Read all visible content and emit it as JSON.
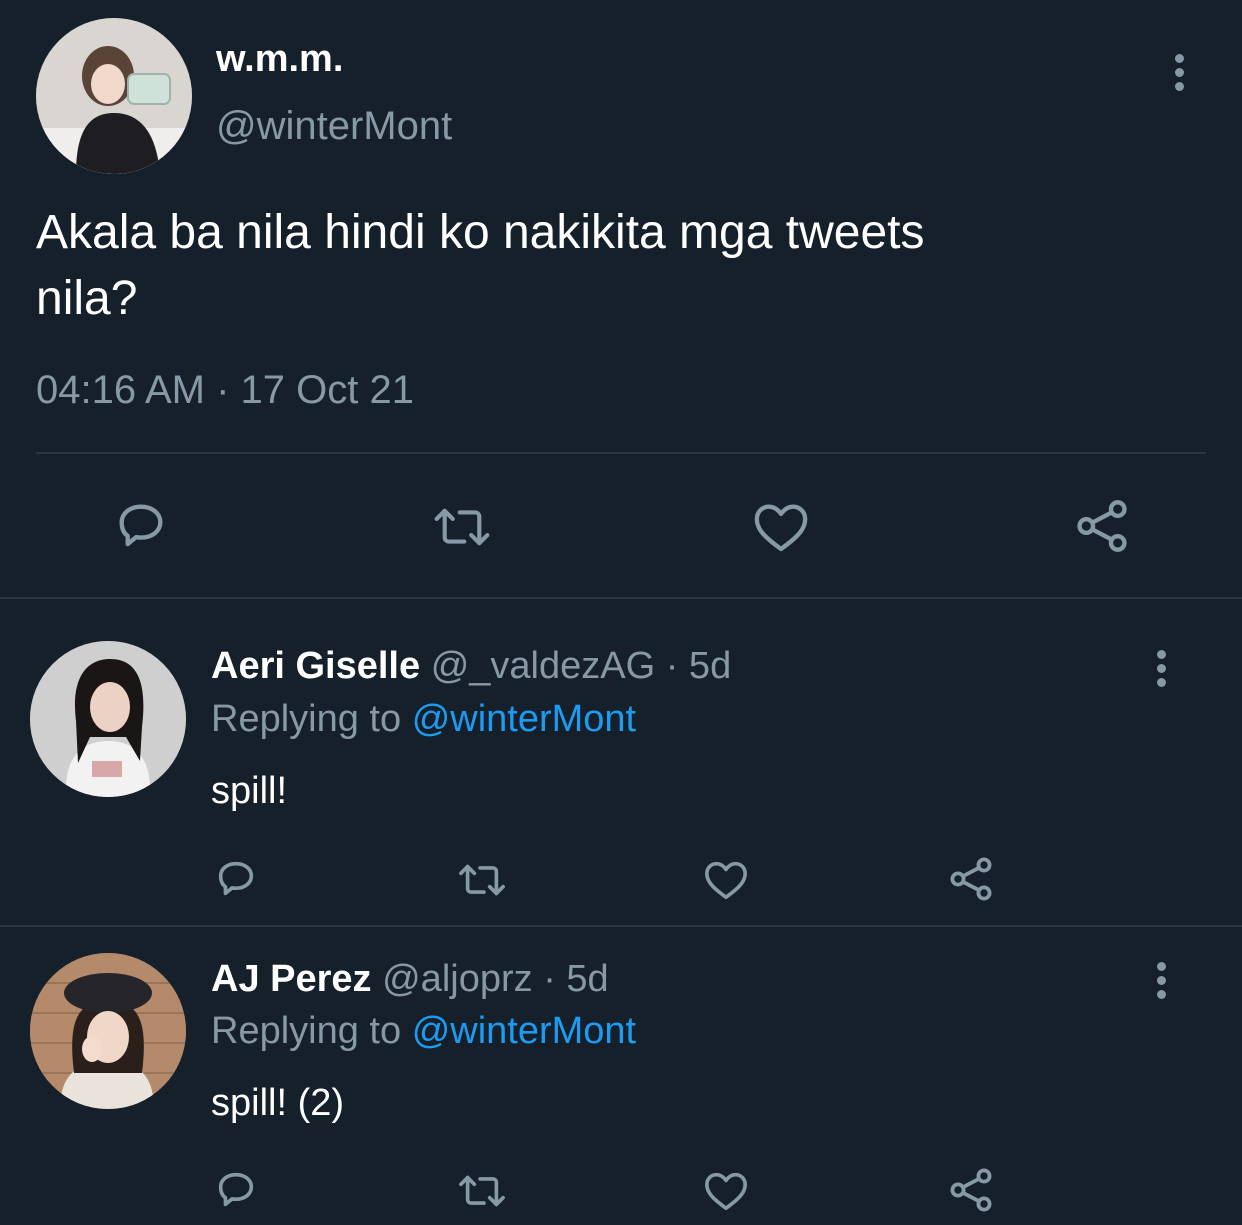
{
  "main_tweet": {
    "display_name": "w.m.m.",
    "handle": "@winterMont",
    "text_line1": "Akala ba nila hindi ko nakikita mga tweets",
    "text_line2": "nila?",
    "timestamp": "04:16 AM · 17 Oct 21"
  },
  "replies": [
    {
      "display_name": "Aeri Giselle",
      "handle": "@_valdezAG",
      "age": "· 5d",
      "replying_label": "Replying to",
      "replying_handle": "@winterMont",
      "text": "spill!"
    },
    {
      "display_name": "AJ Perez",
      "handle": "@aljoprz",
      "age": "· 5d",
      "replying_label": "Replying to",
      "replying_handle": "@winterMont",
      "text": "spill! (2)"
    }
  ],
  "icons": {
    "reply": "reply-icon",
    "retweet": "retweet-icon",
    "like": "heart-icon",
    "share": "share-icon",
    "more": "more-icon"
  },
  "colors": {
    "background": "#15202b",
    "text": "#ffffff",
    "muted": "#8899a6",
    "link": "#1d9bf0",
    "divider": "#2a3640"
  }
}
